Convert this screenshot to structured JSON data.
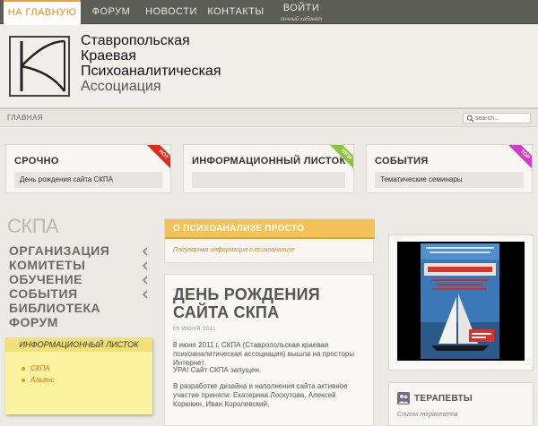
{
  "nav": {
    "home": "НА ГЛАВНУЮ",
    "forum": "ФОРУМ",
    "news": "НОВОСТИ",
    "contacts": "КОНТАКТЫ",
    "login": "ВОЙТИ",
    "login_sub": "личный кабинет"
  },
  "logo": {
    "line1": "Ставропольская",
    "line2": "Краевая",
    "line3": "Психоаналитическая",
    "line4": "Ассоциация"
  },
  "breadcrumb": "ГЛАВНАЯ",
  "search": {
    "placeholder": "search..."
  },
  "boxes": [
    {
      "title": "СРОЧНО",
      "item": "День рождения сайта СКПА",
      "ribbon": "HOT",
      "ribbon_color": "#e22a1c"
    },
    {
      "title": "ИНФОРМАЦИОННЫЙ ЛИСТОК",
      "item": "",
      "ribbon": "NEW",
      "ribbon_color": "#8cc43c"
    },
    {
      "title": "СОБЫТИЯ",
      "item": "Тематические семинары",
      "ribbon": "TOP",
      "ribbon_color": "#d43cc8"
    }
  ],
  "sidebar": {
    "title": "СКПА",
    "menu": [
      "ОРГАНИЗАЦИЯ",
      "КОМИТЕТЫ",
      "ОБУЧЕНИЕ",
      "СОБЫТИЯ",
      "БИБЛИОТЕКА",
      "ФОРУМ"
    ],
    "sticky_title": "ИНФОРМАЦИОННЫЙ ЛИСТОК",
    "sticky_links": [
      "СКПА",
      "Альянс"
    ]
  },
  "psy": {
    "title": "О ПСИХОАНАЛИЗЕ ПРОСТО",
    "subtitle": "Популярная информация о психоанализе"
  },
  "article": {
    "title_line1": "ДЕНЬ РОЖДЕНИЯ",
    "title_line2": "САЙТА СКПА",
    "date": "08 ИЮНЯ 2011",
    "p1": "8 июня 2011 г. СКПА (Ставропольская краевая психоаналитическая ассоциация) вышла на просторы Интернет.",
    "p2": "УРА! Сайт СКПА запущен.",
    "p3": "В разработке дизайна и наполнения сайта активное участие приняли: Екатерина Лоскутова, Алексей Корюкин, Иван Королевский,"
  },
  "therapists": {
    "title": "ТЕРАПЕВТЫ",
    "list_label": "Список терапевтов"
  },
  "colors": {
    "accent": "#e28a1e",
    "nav_bg": "#5e5e58",
    "psy_header": "#f3c35a",
    "sticky_bg": "#fbf3a0"
  }
}
